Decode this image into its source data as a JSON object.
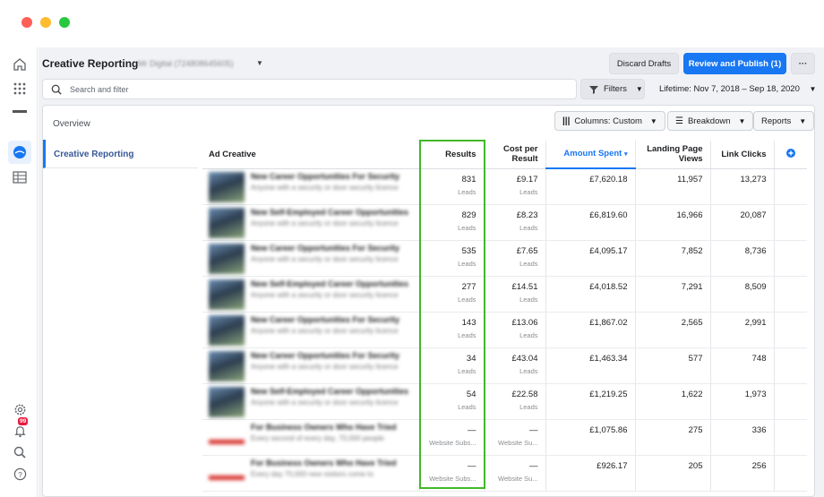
{
  "colors": {
    "accent": "#1877f2",
    "highlight": "#42b72a",
    "red": "#ff5f57",
    "yellow": "#febc2e",
    "green": "#28c840"
  },
  "header": {
    "title": "Creative Reporting",
    "account": "Mr Digital (724808645605)",
    "discard_label": "Discard Drafts",
    "publish_label": "Review and Publish (1)",
    "more_label": "···"
  },
  "search": {
    "placeholder": "Search and filter"
  },
  "filters_label": "Filters",
  "date_range": "Lifetime: Nov 7, 2018 – Sep 18, 2020",
  "notifications_count": "99",
  "toolbar": {
    "columns_label": "Columns: Custom",
    "breakdown_label": "Breakdown",
    "reports_label": "Reports"
  },
  "sidebar": {
    "overview_label": "Overview",
    "active_label": "Creative Reporting"
  },
  "table": {
    "headers": {
      "creative": "Ad Creative",
      "results": "Results",
      "cpr": "Cost per Result",
      "spent": "Amount Spent",
      "lpv": "Landing Page Views",
      "clicks": "Link Clicks"
    },
    "rows": [
      {
        "title": "New Career Opportunities For Security",
        "desc": "Anyone with a security or door security licence",
        "results": "831",
        "results_sub": "Leads",
        "cpr": "£9.17",
        "cpr_sub": "Leads",
        "spent": "£7,620.18",
        "lpv": "11,957",
        "clicks": "13,273",
        "thumb": "photo"
      },
      {
        "title": "New Self-Employed Career Opportunities",
        "desc": "Anyone with a security or door security licence",
        "results": "829",
        "results_sub": "Leads",
        "cpr": "£8.23",
        "cpr_sub": "Leads",
        "spent": "£6,819.60",
        "lpv": "16,966",
        "clicks": "20,087",
        "thumb": "photo"
      },
      {
        "title": "New Career Opportunities For Security",
        "desc": "Anyone with a security or door security licence",
        "results": "535",
        "results_sub": "Leads",
        "cpr": "£7.65",
        "cpr_sub": "Leads",
        "spent": "£4,095.17",
        "lpv": "7,852",
        "clicks": "8,736",
        "thumb": "photo"
      },
      {
        "title": "New Self-Employed Career Opportunities",
        "desc": "Anyone with a security or door security licence",
        "results": "277",
        "results_sub": "Leads",
        "cpr": "£14.51",
        "cpr_sub": "Leads",
        "spent": "£4,018.52",
        "lpv": "7,291",
        "clicks": "8,509",
        "thumb": "photo"
      },
      {
        "title": "New Career Opportunities For Security",
        "desc": "Anyone with a security or door security licence",
        "results": "143",
        "results_sub": "Leads",
        "cpr": "£13.06",
        "cpr_sub": "Leads",
        "spent": "£1,867.02",
        "lpv": "2,565",
        "clicks": "2,991",
        "thumb": "photo"
      },
      {
        "title": "New Career Opportunities For Security",
        "desc": "Anyone with a security or door security licence",
        "results": "34",
        "results_sub": "Leads",
        "cpr": "£43.04",
        "cpr_sub": "Leads",
        "spent": "£1,463.34",
        "lpv": "577",
        "clicks": "748",
        "thumb": "photo"
      },
      {
        "title": "New Self-Employed Career Opportunities",
        "desc": "Anyone with a security or door security licence",
        "results": "54",
        "results_sub": "Leads",
        "cpr": "£22.58",
        "cpr_sub": "Leads",
        "spent": "£1,219.25",
        "lpv": "1,622",
        "clicks": "1,973",
        "thumb": "photo"
      },
      {
        "title": "For Business Owners Who Have Tried",
        "desc": "Every second of every day, 70,000 people",
        "results": "—",
        "results_sub": "Website Subs...",
        "cpr": "—",
        "cpr_sub": "Website Su...",
        "spent": "£1,075.86",
        "lpv": "275",
        "clicks": "336",
        "thumb": "red"
      },
      {
        "title": "For Business Owners Who Have Tried",
        "desc": "Every day 70,000 new visitors come to",
        "results": "—",
        "results_sub": "Website Subs...",
        "cpr": "—",
        "cpr_sub": "Website Su...",
        "spent": "£926.17",
        "lpv": "205",
        "clicks": "256",
        "thumb": "red"
      }
    ]
  }
}
